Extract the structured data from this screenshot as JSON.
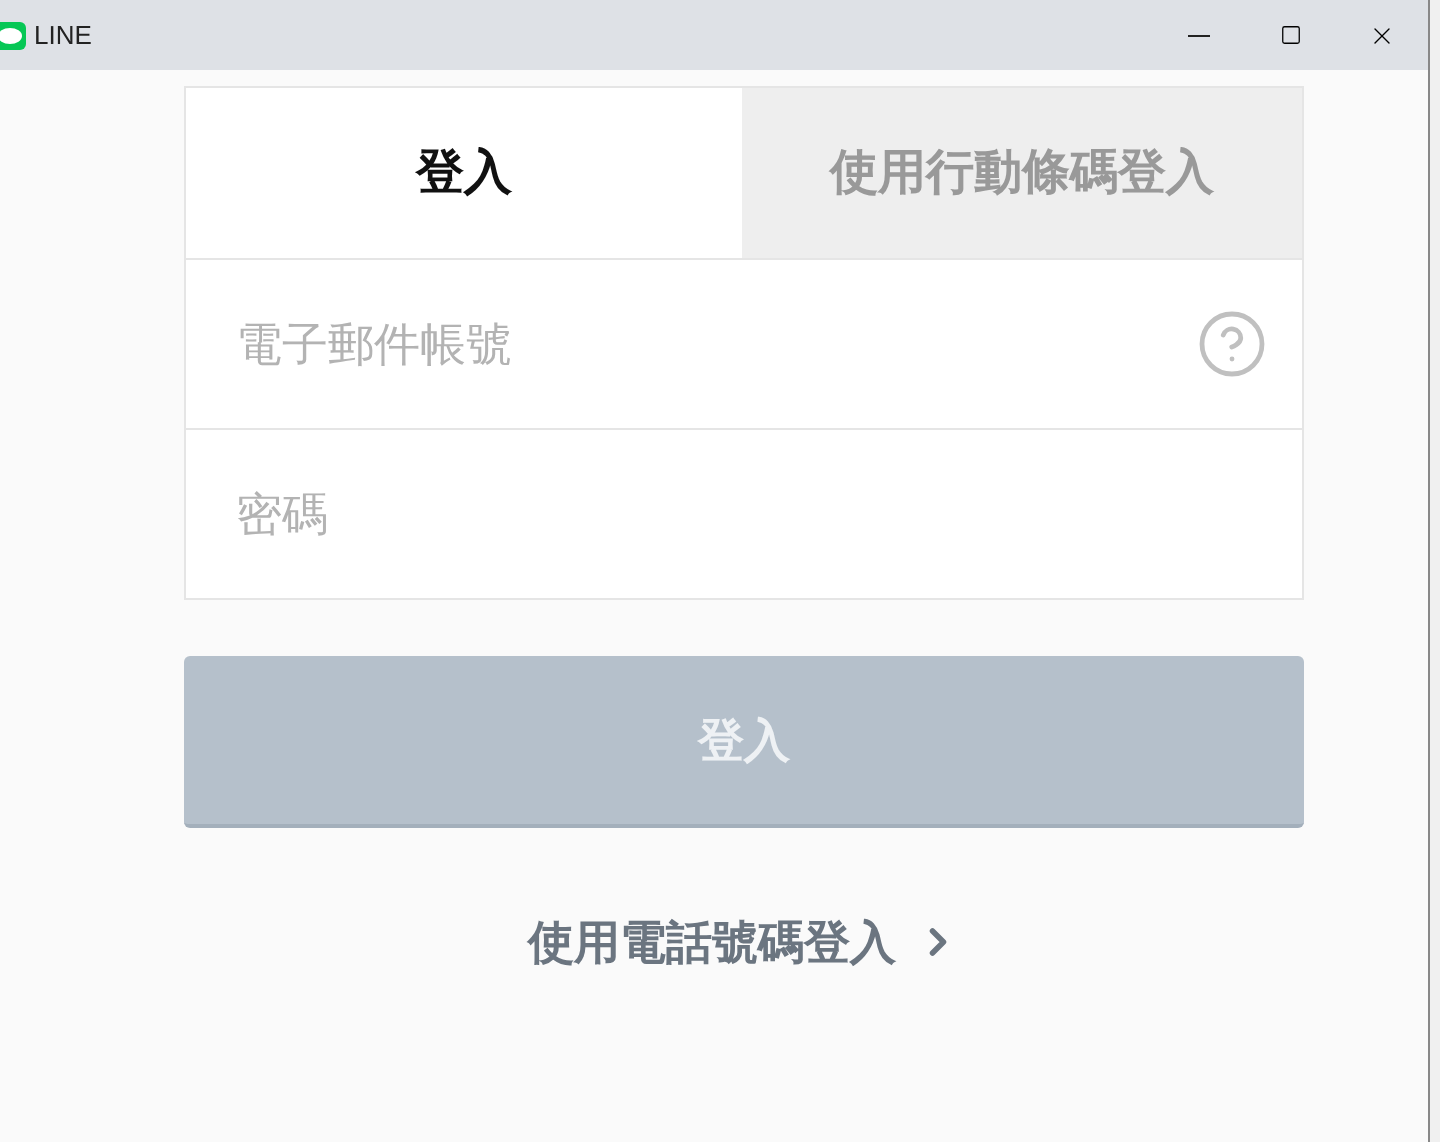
{
  "window": {
    "title": "LINE"
  },
  "tabs": [
    {
      "label": "登入",
      "selected": true
    },
    {
      "label": "使用行動條碼登入",
      "selected": false
    }
  ],
  "fields": [
    {
      "placeholder": "電子郵件帳號",
      "help": true
    },
    {
      "placeholder": "密碼",
      "help": false
    }
  ],
  "login_button": {
    "label": "登入",
    "disabled": true
  },
  "phone_link": {
    "label": "使用電話號碼登入"
  }
}
